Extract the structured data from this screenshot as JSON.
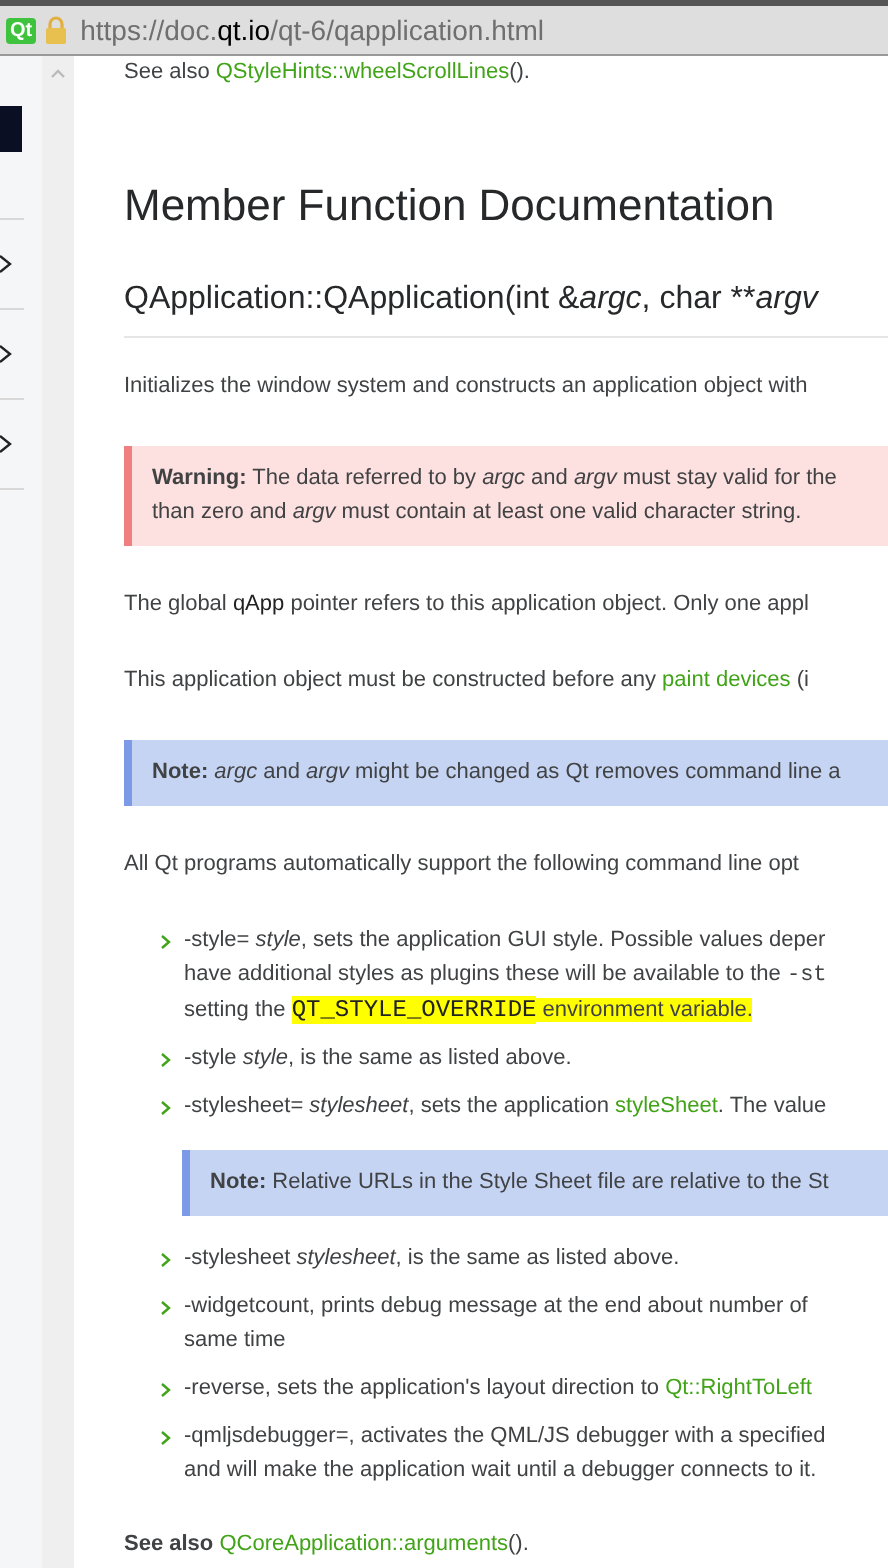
{
  "address_bar": {
    "badge": "Qt",
    "url": [
      {
        "kind": "dim",
        "t": "https://doc."
      },
      {
        "kind": "strong",
        "t": "qt.io"
      },
      {
        "kind": "dim",
        "t": "/qt-6/qapplication.html"
      }
    ]
  },
  "content": [
    {
      "kind": "para",
      "lines": [
        [
          {
            "kind": "text",
            "t": "See also "
          },
          {
            "kind": "link",
            "t": "QStyleHints::wheelScrollLines"
          },
          {
            "kind": "text",
            "t": "()."
          }
        ]
      ]
    },
    {
      "kind": "h1",
      "text": "Member Function Documentation"
    },
    {
      "kind": "h2",
      "segs": [
        {
          "kind": "text",
          "t": "QApplication::QApplication(int &*argc*, char "
        },
        {
          "kind": "plain",
          "t": "**"
        },
        {
          "kind": "text",
          "t": "*argv*"
        }
      ]
    },
    {
      "kind": "para",
      "lines": [
        [
          {
            "kind": "text",
            "t": "Initializes the window system and constructs an application object with"
          }
        ]
      ]
    },
    {
      "kind": "warning",
      "lines": [
        [
          {
            "kind": "text",
            "t": "**Warning:** The data referred to by *argc* and *argv* must stay valid for the"
          }
        ],
        [
          {
            "kind": "text",
            "t": "than zero and *argv* must contain at least one valid character string."
          }
        ]
      ]
    },
    {
      "kind": "para",
      "lines": [
        [
          {
            "kind": "text",
            "t": "The global "
          },
          {
            "kind": "dark",
            "t": "qApp"
          },
          {
            "kind": "text",
            "t": " pointer refers to this application object. Only one appl"
          }
        ]
      ]
    },
    {
      "kind": "para",
      "lines": [
        [
          {
            "kind": "text",
            "t": "This application object must be constructed before any "
          },
          {
            "kind": "link",
            "t": "paint devices"
          },
          {
            "kind": "text",
            "t": " (i"
          }
        ]
      ]
    },
    {
      "kind": "note",
      "lines": [
        [
          {
            "kind": "text",
            "t": "**Note:** *argc* and *argv* might be changed as Qt removes command line a"
          }
        ]
      ]
    },
    {
      "kind": "para",
      "lines": [
        [
          {
            "kind": "text",
            "t": "All Qt programs automatically support the following command line opt"
          }
        ]
      ]
    },
    {
      "kind": "list",
      "items": [
        {
          "kind": "item",
          "lines": [
            [
              {
                "kind": "text",
                "t": "-style= *style*, sets the application GUI style. Possible values deper"
              }
            ],
            [
              {
                "kind": "text",
                "t": "have additional styles as plugins these will be available to the "
              },
              {
                "kind": "code",
                "t": "-st"
              }
            ],
            [
              {
                "kind": "text",
                "t": "setting the "
              },
              {
                "kind": "mark_code",
                "t": "QT_STYLE_OVERRIDE"
              },
              {
                "kind": "mark",
                "t": " environment variable."
              }
            ]
          ]
        },
        {
          "kind": "item",
          "lines": [
            [
              {
                "kind": "text",
                "t": "-style *style*, is the same as listed above."
              }
            ]
          ]
        },
        {
          "kind": "item",
          "lines": [
            [
              {
                "kind": "text",
                "t": "-stylesheet= *stylesheet*, sets the application "
              },
              {
                "kind": "link",
                "t": "styleSheet"
              },
              {
                "kind": "text",
                "t": ". The value"
              }
            ]
          ]
        },
        {
          "kind": "note",
          "lines": [
            [
              {
                "kind": "text",
                "t": "**Note:** Relative URLs in the Style Sheet file are relative to the St"
              }
            ]
          ]
        },
        {
          "kind": "item",
          "lines": [
            [
              {
                "kind": "text",
                "t": "-stylesheet *stylesheet*, is the same as listed above."
              }
            ]
          ]
        },
        {
          "kind": "item",
          "lines": [
            [
              {
                "kind": "text",
                "t": "-widgetcount, prints debug message at the end about number of"
              }
            ],
            [
              {
                "kind": "text",
                "t": "same time"
              }
            ]
          ]
        },
        {
          "kind": "item",
          "lines": [
            [
              {
                "kind": "text",
                "t": "-reverse, sets the application's layout direction to "
              },
              {
                "kind": "link",
                "t": "Qt::RightToLeft"
              }
            ]
          ]
        },
        {
          "kind": "item",
          "lines": [
            [
              {
                "kind": "text",
                "t": "-qmljsdebugger=, activates the QML/JS debugger with a specified"
              }
            ],
            [
              {
                "kind": "text",
                "t": "and will make the application wait until a debugger connects to it."
              }
            ]
          ]
        }
      ]
    },
    {
      "kind": "para",
      "lines": [
        [
          {
            "kind": "bold",
            "t": "See also "
          },
          {
            "kind": "link",
            "t": "QCoreApplication::arguments"
          },
          {
            "kind": "text",
            "t": "()."
          }
        ]
      ]
    }
  ]
}
